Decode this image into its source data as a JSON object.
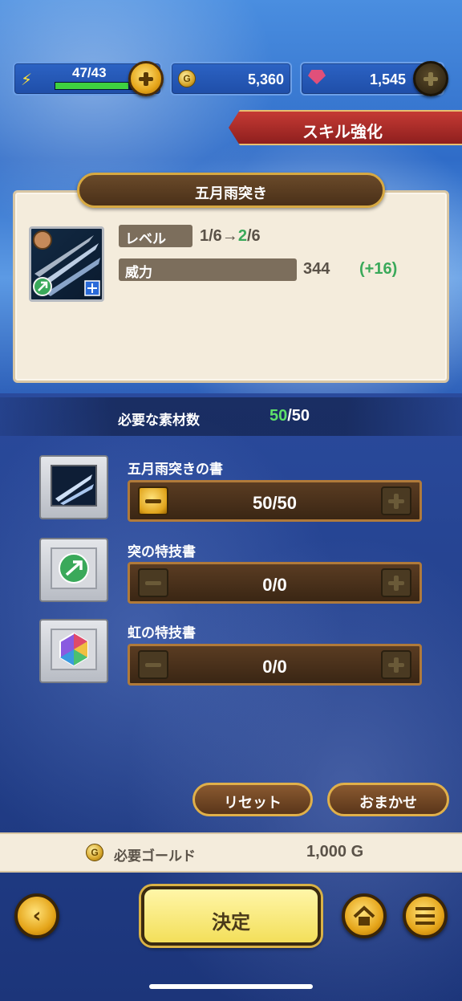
{
  "status_bar": {
    "stamina": "47/43",
    "stamina_fill": 0.95,
    "gold": "5,360",
    "gems": "1,545"
  },
  "header": {
    "title": "スキル強化"
  },
  "skill": {
    "name": "五月雨突き",
    "level_label": "レベル",
    "level_from": "1/6→",
    "level_to": "2",
    "level_max": "/6",
    "power_label": "威力",
    "power_value": "344",
    "power_delta": "(+16)"
  },
  "materials": {
    "required_label": "必要な素材数",
    "required_current": "50",
    "required_total": "/50",
    "items": [
      {
        "name": "五月雨突きの書",
        "count": "50/50"
      },
      {
        "name": "突の特技書",
        "count": "0/0"
      },
      {
        "name": "虹の特技書",
        "count": "0/0"
      }
    ]
  },
  "actions": {
    "reset": "リセット",
    "auto": "おまかせ"
  },
  "cost": {
    "label": "必要ゴールド",
    "value": "1,000 G"
  },
  "footer": {
    "confirm": "決定"
  },
  "colors": {
    "accent_green": "#3aa95a",
    "ribbon_red": "#b3302c",
    "gold_border": "#d7a942"
  }
}
